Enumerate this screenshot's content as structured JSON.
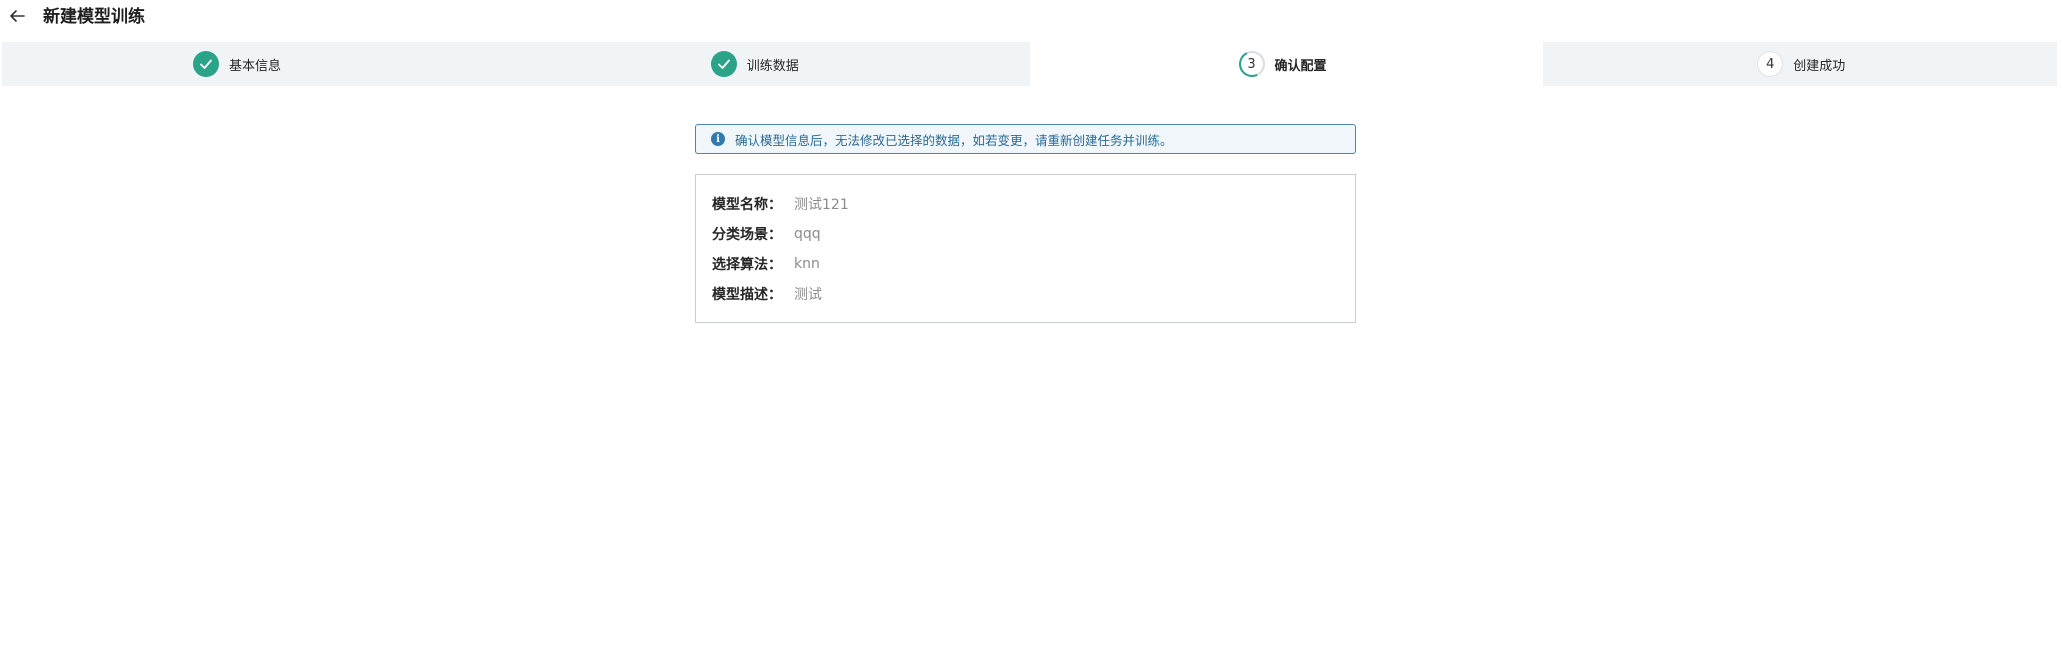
{
  "header": {
    "back_icon": "arrow-left-icon",
    "title": "新建模型训练"
  },
  "steps": [
    {
      "number": "1",
      "label": "基本信息",
      "status": "done"
    },
    {
      "number": "2",
      "label": "训练数据",
      "status": "done"
    },
    {
      "number": "3",
      "label": "确认配置",
      "status": "current"
    },
    {
      "number": "4",
      "label": "创建成功",
      "status": "pending"
    }
  ],
  "colors": {
    "accent": "#2aa389",
    "step_bg": "#f0f4f7",
    "alert_border": "#4a86b0",
    "alert_text": "#2a6a96"
  },
  "alert": {
    "icon": "info-icon",
    "text": "确认模型信息后，无法修改已选择的数据，如若变更，请重新创建任务并训练。"
  },
  "model_info": {
    "rows": [
      {
        "label": "模型名称：",
        "value": "测试121"
      },
      {
        "label": "分类场景：",
        "value": "qqq"
      },
      {
        "label": "选择算法：",
        "value": "knn"
      },
      {
        "label": "模型描述：",
        "value": "测试"
      }
    ]
  }
}
